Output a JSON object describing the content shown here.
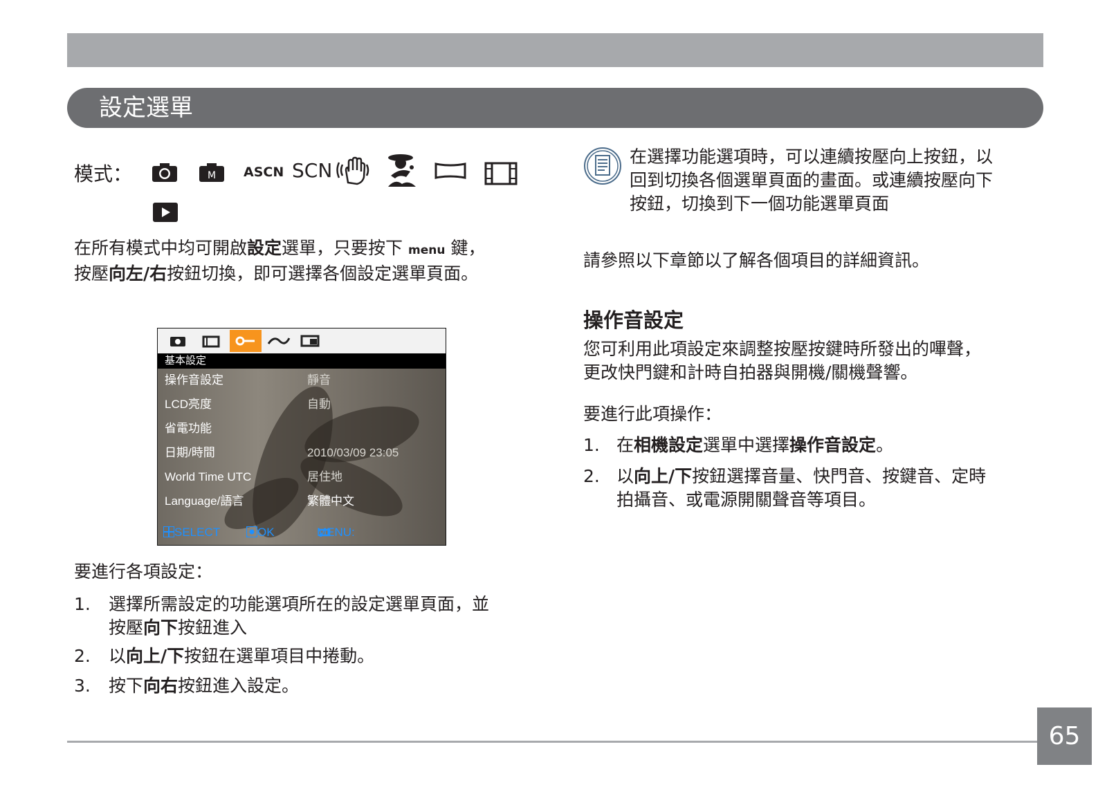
{
  "header": {
    "title": "設定選單"
  },
  "modes": {
    "label": "模式：",
    "ascn_text": "ASCN",
    "scn_text": "SCN",
    "icons": [
      "camera-auto-icon",
      "camera-manual-icon",
      "ascn-icon",
      "scn-icon",
      "anti-shake-icon",
      "portrait-beauty-icon",
      "panorama-icon",
      "movie-icon",
      "playback-icon"
    ]
  },
  "intro": {
    "part1": "在所有模式中均可開啟",
    "bold1": "設定",
    "part2": "選單，只要按下",
    "menu_word": "menu",
    "part3": "鍵，",
    "part4": "按壓",
    "bold2": "向左/右",
    "part5": "按鈕切換，即可選擇各個設定選單頁面。"
  },
  "camera_screen": {
    "header": "基本設定",
    "rows": [
      {
        "label": "操作音設定",
        "value": "靜音"
      },
      {
        "label": "LCD亮度",
        "value": "自動"
      },
      {
        "label": "省電功能",
        "value": ""
      },
      {
        "label": "日期/時間",
        "value": "2010/03/09 23:05"
      },
      {
        "label": "World Time UTC",
        "value": "居住地"
      },
      {
        "label": "Language/語言",
        "value": "繁體中文"
      }
    ],
    "footer": {
      "select": "SELECT",
      "ok": "OK",
      "menu": "MENU:"
    }
  },
  "left_steps": {
    "heading": "要進行各項設定：",
    "step1": {
      "num": "1.",
      "line1": "選擇所需設定的功能選項所在的設定選單頁面，並",
      "line2a": "按壓",
      "line2b": "向下",
      "line2c": "按鈕進入"
    },
    "step2": {
      "num": "2.",
      "a": "以",
      "b": "向上/下",
      "c": "按鈕在選單項目中捲動。"
    },
    "step3": {
      "num": "3.",
      "a": "按下",
      "b": "向右",
      "c": "按鈕進入設定。"
    }
  },
  "note": {
    "line1": "在選擇功能選項時，可以連續按壓向上按鈕，以",
    "line2": "回到切換各個選單頁面的畫面。或連續按壓向下",
    "line3": "按鈕，切換到下一個功能選單頁面"
  },
  "reference": "請參照以下章節以了解各個項目的詳細資訊。",
  "section": {
    "heading": "操作音設定",
    "desc1": "您可利用此項設定來調整按壓按鍵時所發出的嗶聲，",
    "desc2": "更改快門鍵和計時自拍器與開機/關機聲響。",
    "steps_heading": "要進行此項操作：",
    "step1": {
      "num": "1.",
      "a": "在",
      "b": "相機設定",
      "c": "選單中選擇",
      "d": "操作音設定",
      "e": "。"
    },
    "step2": {
      "num": "2.",
      "a": "以",
      "b": "向上/下",
      "c": "按鈕選擇音量、快門音、按鍵音、定時",
      "line2": "拍攝音、或電源開關聲音等項目。"
    }
  },
  "page_number": "65",
  "colors": {
    "accent_orange": "#f7941d",
    "title_bar": "#6d6e71",
    "top_bar": "#a7a9ac",
    "page_box": "#808285"
  }
}
